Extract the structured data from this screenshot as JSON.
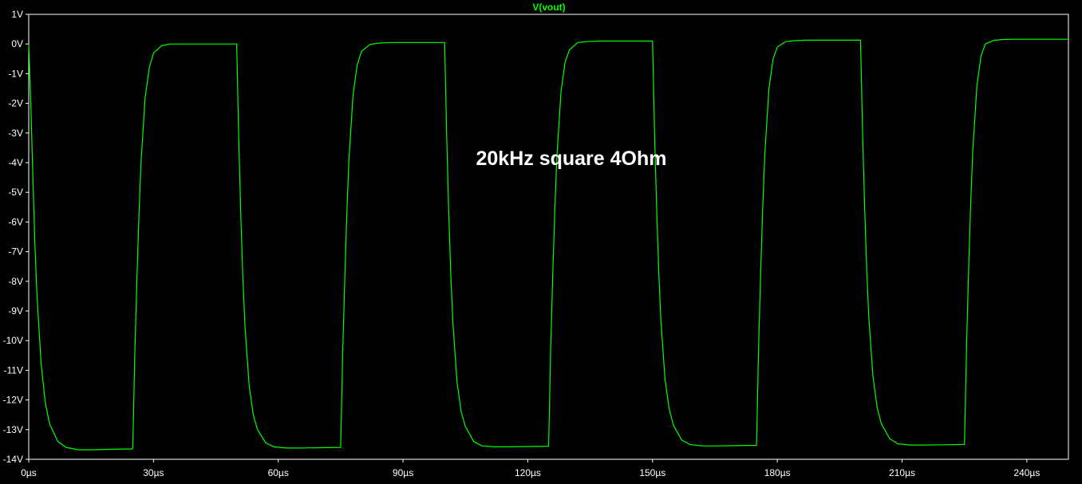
{
  "chart_data": {
    "type": "line",
    "title": "V(vout)",
    "annotation": "20kHz square 4Ohm",
    "xlabel": "",
    "ylabel": "",
    "xunit": "µs",
    "yunit": "V",
    "xlim": [
      0,
      250
    ],
    "ylim": [
      -14,
      1
    ],
    "x_ticks": [
      0,
      30,
      60,
      90,
      120,
      150,
      180,
      210,
      240
    ],
    "x_tick_labels": [
      "0µs",
      "30µs",
      "60µs",
      "90µs",
      "120µs",
      "150µs",
      "180µs",
      "210µs",
      "240µs"
    ],
    "y_ticks": [
      1,
      0,
      -1,
      -2,
      -3,
      -4,
      -5,
      -6,
      -7,
      -8,
      -9,
      -10,
      -11,
      -12,
      -13,
      -14
    ],
    "y_tick_labels": [
      "1V",
      "0V",
      "-1V",
      "-2V",
      "-3V",
      "-4V",
      "-5V",
      "-6V",
      "-7V",
      "-8V",
      "-9V",
      "-10V",
      "-11V",
      "-12V",
      "-13V",
      "-14V"
    ],
    "grid": false,
    "colors": {
      "background": "#000000",
      "axes": "#ffffff",
      "trace": "#00ff00",
      "title": "#00ff00",
      "annotation": "#ffffff"
    },
    "series": [
      {
        "name": "V(vout)",
        "x": [
          0,
          0.5,
          1,
          1.5,
          2,
          3,
          4,
          5,
          7,
          9,
          12,
          15,
          20,
          25,
          25.2,
          25.5,
          26,
          26.5,
          27,
          28,
          29,
          30,
          32,
          34,
          37,
          40,
          45,
          50,
          50.2,
          50.5,
          51,
          51.5,
          52,
          53,
          54,
          55,
          57,
          59,
          62,
          65,
          70,
          75,
          75.2,
          75.5,
          76,
          76.5,
          77,
          78,
          79,
          80,
          82,
          84,
          87,
          90,
          95,
          100,
          100.2,
          100.5,
          101,
          101.5,
          102,
          103,
          104,
          105,
          107,
          109,
          112,
          115,
          120,
          125,
          125.2,
          125.5,
          126,
          126.5,
          127,
          128,
          129,
          130,
          132,
          134,
          137,
          140,
          145,
          150,
          150.2,
          150.5,
          151,
          151.5,
          152,
          153,
          154,
          155,
          157,
          159,
          162,
          165,
          170,
          175,
          175.2,
          175.5,
          176,
          176.5,
          177,
          178,
          179,
          180,
          182,
          184,
          187,
          190,
          195,
          200,
          200.2,
          200.5,
          201,
          201.5,
          202,
          203,
          204,
          205,
          207,
          209,
          212,
          215,
          220,
          225,
          225.2,
          225.5,
          226,
          226.5,
          227,
          228,
          229,
          230,
          232,
          234,
          237,
          240,
          245,
          250
        ],
        "y": [
          0,
          -2,
          -4.5,
          -6.8,
          -8.5,
          -10.8,
          -12.1,
          -12.8,
          -13.4,
          -13.6,
          -13.68,
          -13.68,
          -13.66,
          -13.65,
          -12.5,
          -10.5,
          -8,
          -5.8,
          -4,
          -1.8,
          -0.8,
          -0.3,
          -0.05,
          0,
          0,
          0,
          0,
          0,
          -1.2,
          -3.2,
          -5.8,
          -7.9,
          -9.5,
          -11.5,
          -12.5,
          -13,
          -13.45,
          -13.58,
          -13.62,
          -13.62,
          -13.61,
          -13.6,
          -12.4,
          -10.4,
          -7.9,
          -5.7,
          -3.9,
          -1.7,
          -0.7,
          -0.25,
          -0.02,
          0.03,
          0.05,
          0.05,
          0.05,
          0.05,
          -1.1,
          -3.1,
          -5.7,
          -7.8,
          -9.4,
          -11.4,
          -12.4,
          -12.9,
          -13.4,
          -13.55,
          -13.58,
          -13.58,
          -13.57,
          -13.56,
          -12.4,
          -10.3,
          -7.8,
          -5.6,
          -3.8,
          -1.6,
          -0.6,
          -0.2,
          0.05,
          0.08,
          0.1,
          0.1,
          0.1,
          0.1,
          -1.1,
          -3.1,
          -5.6,
          -7.7,
          -9.3,
          -11.3,
          -12.3,
          -12.85,
          -13.35,
          -13.5,
          -13.55,
          -13.55,
          -13.54,
          -13.53,
          -12.3,
          -10.2,
          -7.7,
          -5.5,
          -3.7,
          -1.5,
          -0.5,
          -0.1,
          0.08,
          0.11,
          0.13,
          0.13,
          0.13,
          0.13,
          -1,
          -3,
          -5.5,
          -7.6,
          -9.2,
          -11.2,
          -12.25,
          -12.8,
          -13.3,
          -13.48,
          -13.52,
          -13.52,
          -13.51,
          -13.5,
          -12.3,
          -10.2,
          -7.6,
          -5.4,
          -3.6,
          -1.4,
          -0.4,
          0,
          0.12,
          0.15,
          0.16,
          0.16,
          0.16,
          0.16
        ]
      }
    ]
  }
}
